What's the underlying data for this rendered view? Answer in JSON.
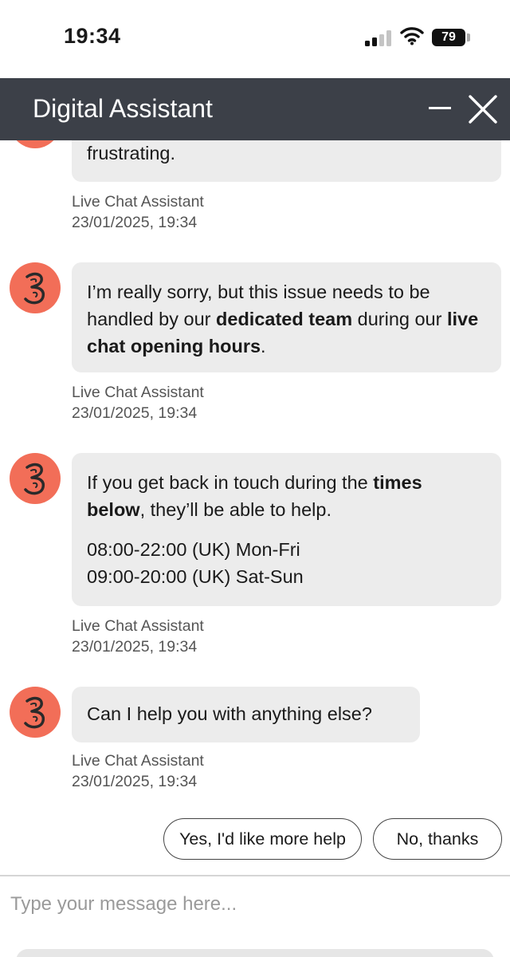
{
  "status_bar": {
    "time": "19:34",
    "battery": "79",
    "icons": [
      "cellular-signal-icon",
      "wifi-icon",
      "battery-icon"
    ]
  },
  "header": {
    "title": "Digital Assistant",
    "icons": [
      "minimize-icon",
      "close-icon"
    ],
    "background": "#3c4048"
  },
  "messages": [
    {
      "text": "frustrating.",
      "sender": "Live Chat Assistant",
      "timestamp": "23/01/2025, 19:34"
    },
    {
      "parts": [
        {
          "text": "I’m really sorry, but this issue needs to be handled by our "
        },
        {
          "text": "dedicated team",
          "bold": true
        },
        {
          "text": " during our "
        },
        {
          "text": "live chat opening hours",
          "bold": true
        },
        {
          "text": "."
        }
      ],
      "sender": "Live Chat Assistant",
      "timestamp": "23/01/2025, 19:34"
    },
    {
      "parts": [
        {
          "text": "If you get back in touch during the "
        },
        {
          "text": "times below",
          "bold": true
        },
        {
          "text": ", they’ll be able to help."
        }
      ],
      "hours": [
        "08:00-22:00 (UK) Mon-Fri",
        "09:00-20:00 (UK) Sat-Sun"
      ],
      "sender": "Live Chat Assistant",
      "timestamp": "23/01/2025, 19:34"
    },
    {
      "text": "Can I help you with anything else?",
      "sender": "Live Chat Assistant",
      "timestamp": "23/01/2025, 19:34"
    }
  ],
  "quick_replies": [
    "Yes, I'd like more help",
    "No, thanks"
  ],
  "input": {
    "placeholder": "Type your message here...",
    "value": ""
  },
  "colors": {
    "avatar": "#f26e58",
    "bubble": "#ececec",
    "header": "#3c4048"
  }
}
